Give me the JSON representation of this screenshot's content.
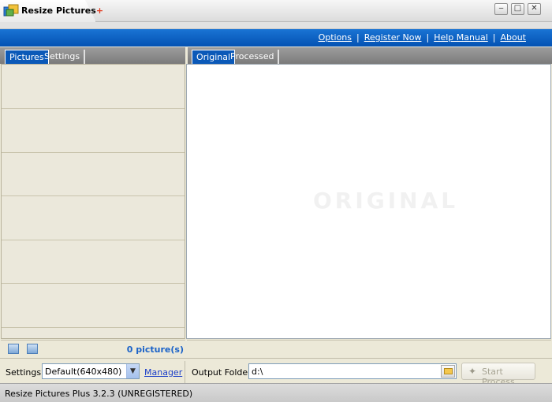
{
  "window": {
    "title_main": "Resize Pictures",
    "title_plus": "+",
    "minimize": "‒",
    "maximize": "□",
    "close": "✕"
  },
  "menu": {
    "items": [
      "Options",
      "Register Now",
      "Help Manual",
      "About"
    ],
    "separator": "|"
  },
  "left_panel": {
    "tabs": [
      "Pictures",
      "Settings"
    ],
    "active_tab": "Pictures",
    "picture_count": "0 picture(s)"
  },
  "right_panel": {
    "tabs": [
      "Original",
      "Processed"
    ],
    "active_tab": "Original",
    "watermark": "ORIGINAL"
  },
  "bottom": {
    "settings_label": "Settings:",
    "settings_value": "Default(640x480)",
    "manager_link": "Manager",
    "output_label": "Output Folder:",
    "output_value": "d:\\",
    "start_button": "Start Process"
  },
  "status": {
    "text": "Resize Pictures Plus 3.2.3 (UNREGISTERED)"
  },
  "colors": {
    "accent_blue": "#0452b3",
    "count_blue": "#1b63c8"
  },
  "icons": {
    "add_folder": "add-folder-icon",
    "add_picture": "add-picture-icon",
    "browse_folder": "folder-icon",
    "start": "magic-wand-icon"
  }
}
